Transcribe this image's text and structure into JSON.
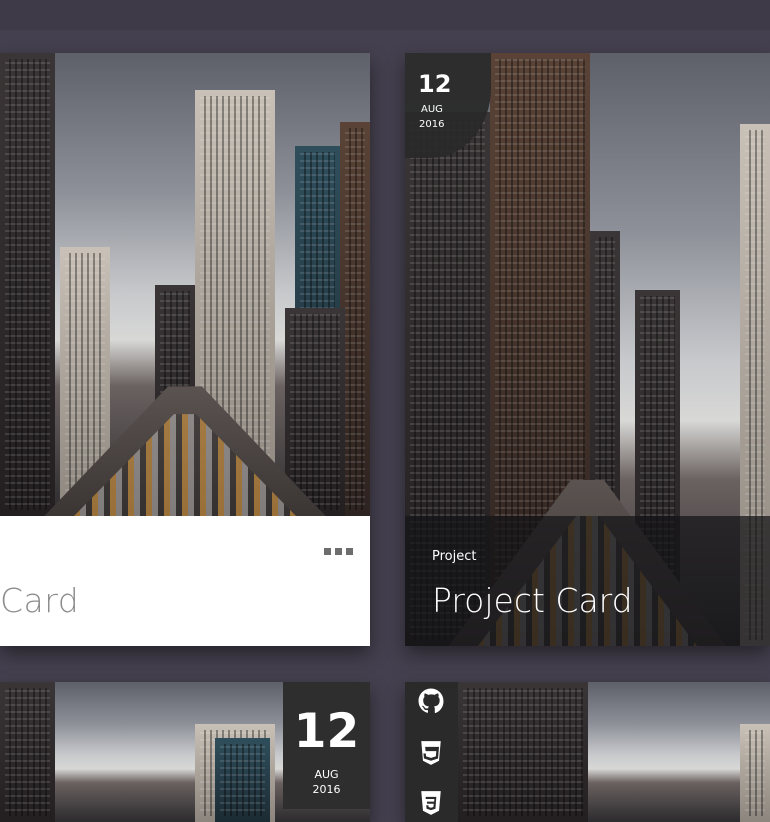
{
  "cards": [
    {
      "title": "Card",
      "menu_icon": "more-dots-icon"
    },
    {
      "subtitle": "Project",
      "title": "Project Card",
      "date": {
        "day": "12",
        "month": "AUG",
        "year": "2016"
      }
    },
    {
      "date": {
        "day": "12",
        "month": "AUG",
        "year": "2016"
      }
    },
    {
      "icons": [
        "github-icon",
        "html5-icon",
        "css3-icon"
      ]
    }
  ],
  "colors": {
    "background": "#45404f",
    "card_white": "#ffffff",
    "badge": "#2e2e2e"
  }
}
